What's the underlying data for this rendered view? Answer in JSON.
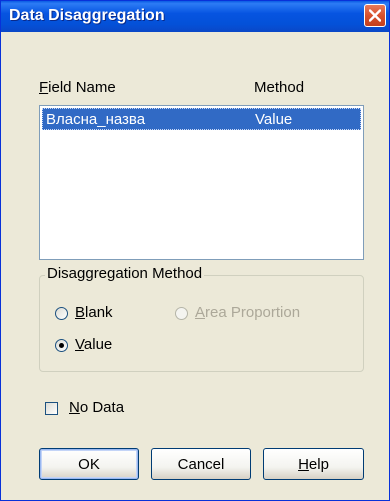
{
  "window": {
    "title": "Data Disaggregation"
  },
  "list": {
    "headers": {
      "field_name_prefix": "",
      "field_name_mnemonic": "F",
      "field_name_rest": "ield Name",
      "method": "Method"
    },
    "rows": [
      {
        "field": "Власна_назва",
        "method": "Value",
        "selected": true
      }
    ]
  },
  "disaggregation": {
    "group_title": "Disaggregation Method",
    "options": [
      {
        "mnemonic": "B",
        "rest": "lank",
        "checked": false,
        "enabled": true
      },
      {
        "mnemonic": "A",
        "rest": "rea Proportion",
        "checked": false,
        "enabled": false
      },
      {
        "mnemonic": "V",
        "rest": "alue",
        "checked": true,
        "enabled": true
      }
    ]
  },
  "no_data": {
    "mnemonic": "N",
    "rest": "o Data",
    "checked": false
  },
  "buttons": {
    "ok": "OK",
    "cancel": "Cancel",
    "help_mnemonic": "H",
    "help_rest": "elp"
  },
  "colors": {
    "title_bar": "#0654e1",
    "selection": "#316ac5",
    "dialog_bg": "#ece9d8",
    "close_button": "#d8512d"
  }
}
